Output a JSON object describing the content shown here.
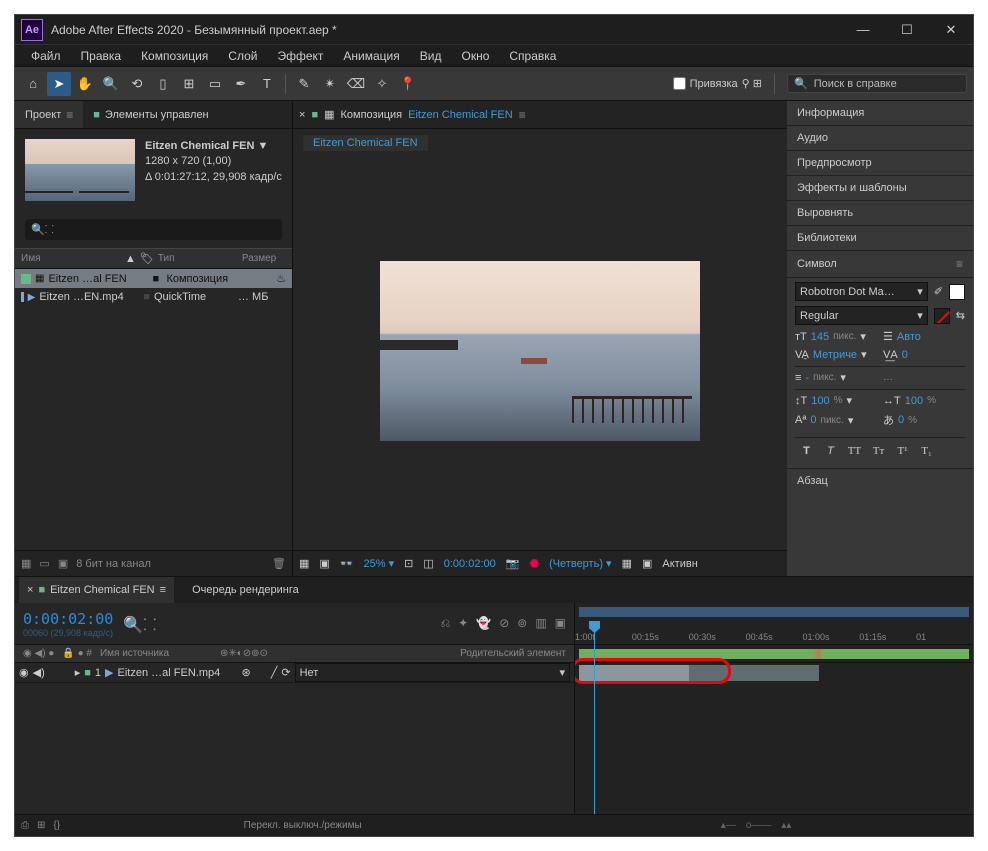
{
  "titlebar": {
    "app": "Adobe After Effects 2020",
    "project": "Безымянный проект.aep *",
    "logo": "Ae"
  },
  "menu": [
    "Файл",
    "Правка",
    "Композиция",
    "Слой",
    "Эффект",
    "Анимация",
    "Вид",
    "Окно",
    "Справка"
  ],
  "toolbar": {
    "snap_label": "Привязка",
    "search_placeholder": "Поиск в справке"
  },
  "project_panel": {
    "tab_project": "Проект",
    "tab_controls": "Элементы управлен",
    "item_name": "Eitzen Chemical FEN ▼",
    "resolution": "1280 x 720 (1,00)",
    "duration": "Δ 0:01:27:12, 29,908 кадр/с",
    "cols": {
      "name": "Имя",
      "type": "Тип",
      "size": "Размер"
    },
    "rows": [
      {
        "name": "Eitzen …al FEN",
        "type": "Композиция",
        "icon": "comp"
      },
      {
        "name": "Eitzen …EN.mp4",
        "type": "QuickTime",
        "size": "… МБ",
        "icon": "mov"
      }
    ],
    "footer_bits": "8 бит на канал"
  },
  "composition": {
    "crumb_prefix": "Композиция",
    "crumb_name": "Eitzen Chemical FEN",
    "subtab": "Eitzen Chemical FEN",
    "zoom": "25%",
    "timecode": "0:00:02:00",
    "quality": "(Четверть)",
    "active_cam": "Активн"
  },
  "right_panels": {
    "info": "Информация",
    "audio": "Аудио",
    "preview": "Предпросмотр",
    "effects": "Эффекты и шаблоны",
    "align": "Выровнять",
    "libraries": "Библиотеки",
    "character": "Символ",
    "paragraph": "Абзац"
  },
  "char": {
    "font": "Robotron Dot Ma…",
    "style": "Regular",
    "size": "145",
    "size_unit": "пикс.",
    "leading": "Авто",
    "kerning": "Метриче",
    "tracking": "0",
    "stroke_dash": "-",
    "stroke_unit": "пикс.",
    "stroke_over": "…",
    "vscale": "100",
    "vscale_unit": "%",
    "hscale": "100",
    "hscale_unit": "%",
    "baseline": "0",
    "baseline_unit": "пикс.",
    "tsume": "0",
    "tsume_unit": "%"
  },
  "timeline": {
    "tab_comp": "Eitzen Chemical FEN",
    "tab_render": "Очередь рендеринга",
    "current_time": "0:00:02:00",
    "frame_info": "00060 (29,908 кадр/с)",
    "col_source": "Имя источника",
    "col_parent": "Родительский элемент",
    "layer_num": "1",
    "layer_name": "Eitzen …al FEN.mp4",
    "parent_value": "Нет",
    "ticks": [
      "1:00f",
      "00:15s",
      "00:30s",
      "00:45s",
      "01:00s",
      "01:15s",
      "01"
    ],
    "footer_toggle": "Перекл. выключ./режимы"
  }
}
